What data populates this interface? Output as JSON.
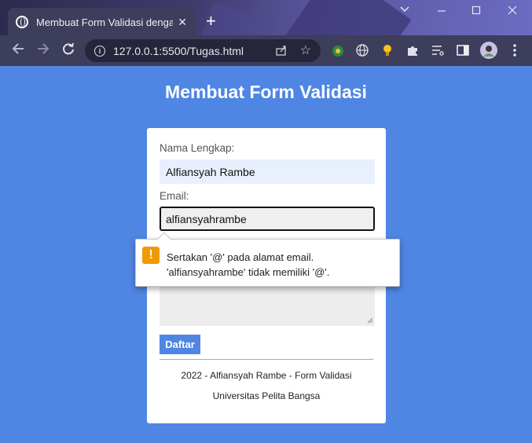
{
  "browser": {
    "tab_title": "Membuat Form Validasi dengan",
    "tab_close": "✕",
    "new_tab": "+",
    "url": "127.0.0.1:5500/Tugas.html",
    "window_controls": {
      "minimize": "⌄",
      "restore": "—",
      "maximize": "☐",
      "close": "✕"
    }
  },
  "page": {
    "title": "Membuat Form Validasi",
    "form": {
      "name_label": "Nama Lengkap:",
      "name_value": "Alfiansyah Rambe",
      "email_label": "Email:",
      "email_value": "alfiansyahrambe",
      "submit_label": "Daftar"
    },
    "footer": {
      "line1": "2022 - Alfiansyah Rambe - Form Validasi",
      "line2": "Universitas Pelita Bangsa"
    }
  },
  "validation_tooltip": {
    "line1": "Sertakan '@' pada alamat email.",
    "line2": "'alfiansyahrambe' tidak memiliki '@'.",
    "icon": "warning-icon"
  },
  "colors": {
    "page_background": "#4f86e3",
    "button": "#4f86e3",
    "warning": "#f29900"
  }
}
